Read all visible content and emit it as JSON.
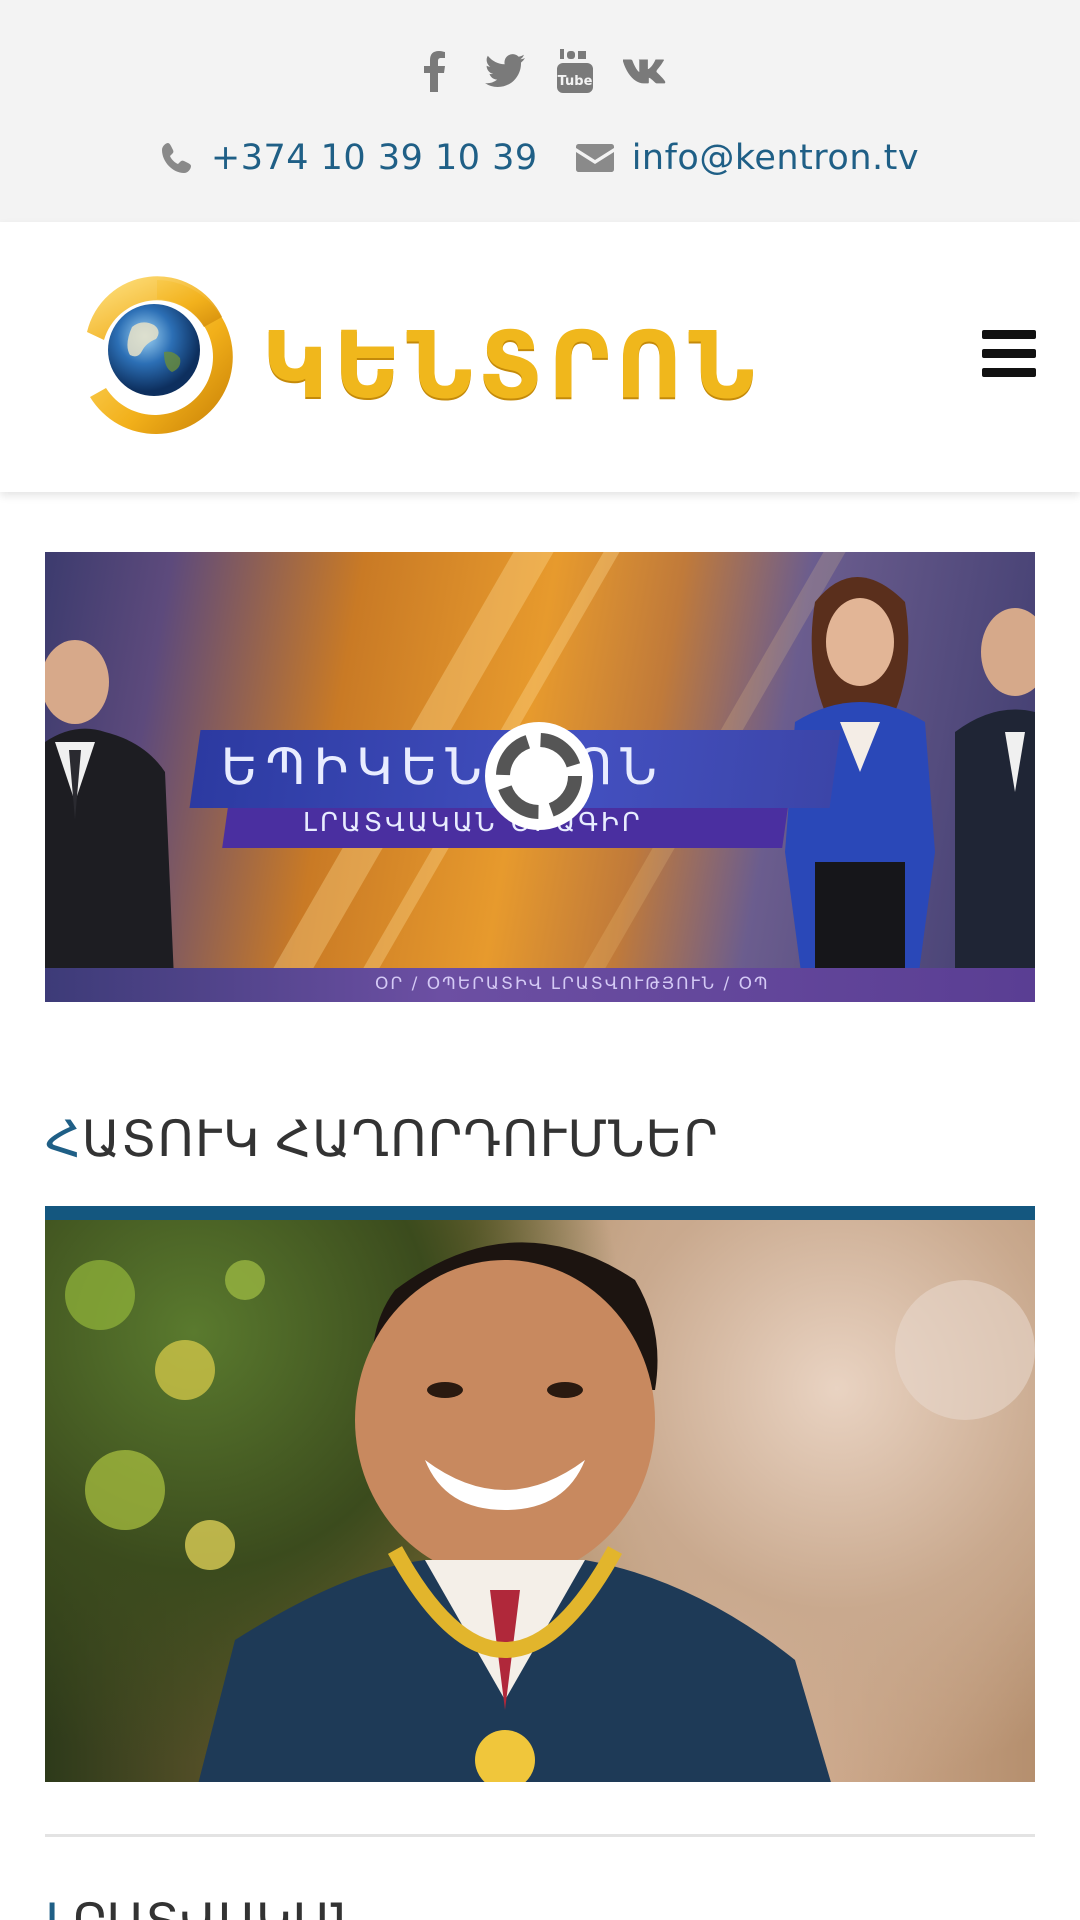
{
  "topbar": {
    "social": [
      {
        "icon": "facebook-icon"
      },
      {
        "icon": "twitter-icon"
      },
      {
        "icon": "youtube-icon",
        "text": "You Tube"
      },
      {
        "icon": "vk-icon"
      }
    ],
    "phone": "+374 10 39 10 39",
    "email": "info@kentron.tv"
  },
  "header": {
    "logo_text": "ԿԵՆՏՐՈՆ",
    "menu_icon": "hamburger-menu-icon"
  },
  "hero": {
    "title": "ԵՊԻԿԵՆՏՐՈՆ",
    "subtitle": "ԼՐԱՏՎԱԿԱՆ ԾՐԱԳԻՐ",
    "ticker": "ՕՐ / ՕՊԵՐԱՏԻՎ ԼՐԱՏՎՈՒԹՅՈՒՆ / ՕՊ"
  },
  "sections": {
    "special": {
      "first_letter": "Հ",
      "rest": "ԱՏՈՒԿ ՀԱՂՈՐԴՈՒՄՆԵՐ"
    },
    "next": {
      "first_letter": "Լ",
      "rest": "ՐԱՏՎԱԿԱՆ"
    }
  },
  "colors": {
    "accent": "#1f5f86",
    "logo": "#f0b71c",
    "topbar_bg": "#f3f3f3",
    "feature_border": "#14577f"
  }
}
